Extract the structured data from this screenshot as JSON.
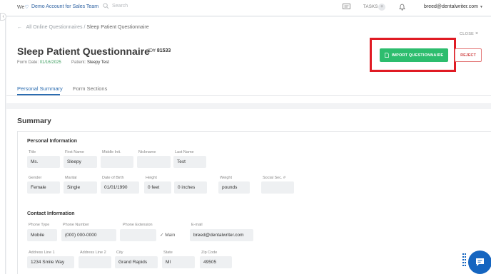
{
  "topbar": {
    "brand_prefix": "We",
    "account": "Demo Account for Sales Team",
    "search_placeholder": "Search",
    "tasks_label": "TASKS",
    "tasks_badge": "+",
    "user_email": "breed@dentalwriter.com"
  },
  "page": {
    "breadcrumb_parent": "All Online Questionnaires",
    "breadcrumb_sep": "/",
    "breadcrumb_current": "Sleep Patient Questionnaire",
    "close_label": "CLOSE",
    "title": "Sleep Patient Questionnaire",
    "id_label": "ID#",
    "id_value": "81533",
    "form_date_label": "Form Date:",
    "form_date_value": "01/16/2025",
    "patient_label": "Patient:",
    "patient_value": "Sleepy Test",
    "import_label": "IMPORT QUESTIONNAIRE",
    "reject_label": "REJECT"
  },
  "tabs": [
    {
      "label": "Personal Summary",
      "active": true
    },
    {
      "label": "Form Sections",
      "active": false
    }
  ],
  "summary": {
    "heading": "Summary",
    "personal_heading": "Personal Information",
    "contact_heading": "Contact Information"
  },
  "personal": {
    "title_label": "Title",
    "title_value": "Ms.",
    "first_label": "First Name",
    "first_value": "Sleepy",
    "middle_label": "Middle Init.",
    "middle_value": "",
    "nick_label": "Nickname",
    "nick_value": "",
    "last_label": "Last Name",
    "last_value": "Test",
    "gender_label": "Gender",
    "gender_value": "Female",
    "marital_label": "Marital",
    "marital_value": "Single",
    "dob_label": "Date of Birth",
    "dob_value": "01/01/1990",
    "height_label": "Height",
    "height_ft": "0 feet",
    "height_in": "0 inches",
    "weight_label": "Weight",
    "weight_value": "pounds",
    "ssn_label": "Social Sec. #",
    "ssn_value": ""
  },
  "contact": {
    "phone_type_label": "Phone Type",
    "phone_type_value": "Mobile",
    "phone_number_label": "Phone Number",
    "phone_number_value": "(000) 000-0000",
    "phone_ext_label": "Phone Extension",
    "phone_ext_value": "",
    "main_label": "Main",
    "email_label": "E-mail",
    "email_value": "breed@dentalwriter.com",
    "addr1_label": "Address Line 1",
    "addr1_value": "1234 Smile Way",
    "addr2_label": "Address Line 2",
    "addr2_value": "",
    "city_label": "City",
    "city_value": "Grand Rapids",
    "state_label": "State",
    "state_value": "MI",
    "zip_label": "Zip Code",
    "zip_value": "49505"
  },
  "colors": {
    "accent_blue": "#2b6cb0",
    "import_green": "#2dbd6e",
    "reject_red": "#d04848",
    "highlight_red": "#e01b24",
    "chat_blue": "#1565c0"
  },
  "icons": [
    "heart-icon",
    "search-icon",
    "message-icon",
    "bell-icon",
    "chevron-down-icon",
    "back-arrow-icon",
    "document-icon",
    "check-icon",
    "chat-icon",
    "collapse-chevron-icon",
    "grip-icon"
  ]
}
